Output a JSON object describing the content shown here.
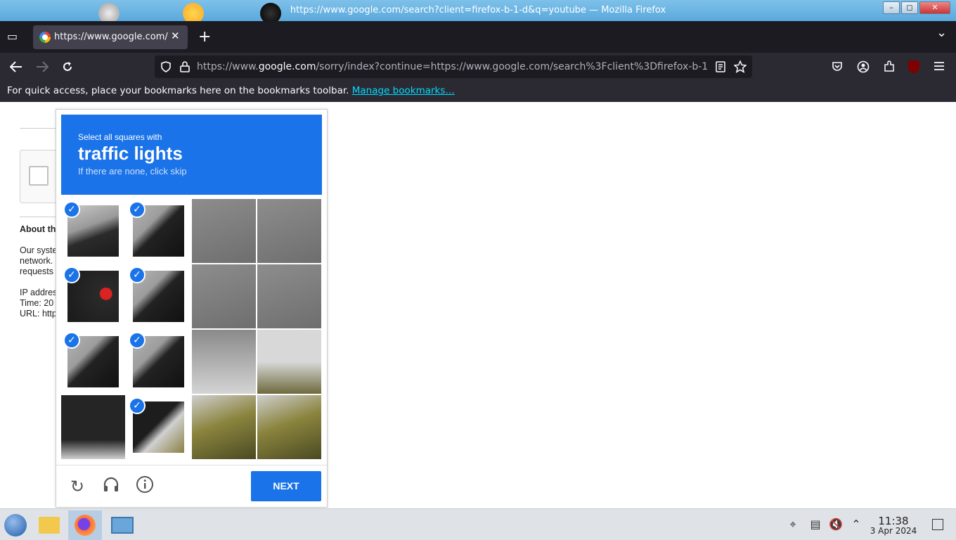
{
  "window": {
    "title": "https://www.google.com/search?client=firefox-b-1-d&q=youtube — Mozilla Firefox",
    "controls": {
      "minimize": "–",
      "maximize": "◻",
      "close": "✕"
    }
  },
  "tabs": [
    {
      "label": "https://www.google.com/",
      "close": "✕"
    }
  ],
  "tabstrip": {
    "new_tab": "+",
    "list_all": "⌄"
  },
  "navbar": {
    "url_host_prefix": "https://www.",
    "url_host": "google.com",
    "url_rest": "/sorry/index?continue=https://www.google.com/search%3Fclient%3Dfirefox-b-1"
  },
  "bookmarks_bar": {
    "message": "For quick access, place your bookmarks here on the bookmarks toolbar.",
    "link": "Manage bookmarks…"
  },
  "page": {
    "about_heading": "About th",
    "body_line1": "Our syste",
    "body_line2": "network.",
    "body_line3": "requests",
    "ip_line": "IP addres",
    "time_line": "Time: 20",
    "url_line": "URL: http"
  },
  "captcha": {
    "instruction": "Select all squares with",
    "target": "traffic lights",
    "hint": "If there are none, click skip",
    "tiles": [
      {
        "selected": true,
        "image": "traffic-light-top"
      },
      {
        "selected": true,
        "image": "traffic-light-housing"
      },
      {
        "selected": false,
        "image": "sky"
      },
      {
        "selected": false,
        "image": "sky"
      },
      {
        "selected": true,
        "image": "red-light"
      },
      {
        "selected": true,
        "image": "traffic-light-housing"
      },
      {
        "selected": false,
        "image": "sky"
      },
      {
        "selected": false,
        "image": "sky"
      },
      {
        "selected": true,
        "image": "traffic-light-housing"
      },
      {
        "selected": true,
        "image": "traffic-light-housing"
      },
      {
        "selected": false,
        "image": "sky-clouds"
      },
      {
        "selected": false,
        "image": "sky-tree"
      },
      {
        "selected": false,
        "image": "traffic-light-bottom"
      },
      {
        "selected": true,
        "image": "traffic-light-tree"
      },
      {
        "selected": false,
        "image": "tree"
      },
      {
        "selected": false,
        "image": "tree"
      }
    ],
    "check_glyph": "✓",
    "reload_icon": "↻",
    "audio_icon": "🎧",
    "info_icon": "ⓘ",
    "next_label": "NEXT"
  },
  "taskbar": {
    "time": "11:38",
    "date": "3 Apr 2024"
  },
  "colors": {
    "captcha_blue": "#1a73e8",
    "firefox_dark": "#2b2a33",
    "link": "#00ddff"
  }
}
